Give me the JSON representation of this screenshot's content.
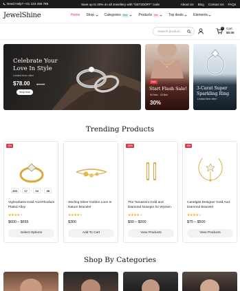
{
  "topbar": {
    "help": "Need Help? +01 123 456 789",
    "promo": "Save up to 20% on all Jewellery with \"GET20OFF\" code",
    "links": [
      "About Us",
      "Blog",
      "Contact Us",
      "FAQs"
    ]
  },
  "header": {
    "logo": "JewelShine",
    "nav": [
      {
        "label": "Home",
        "badge": "",
        "active": true
      },
      {
        "label": "Shop",
        "badge": ""
      },
      {
        "label": "Categories",
        "badge": "New"
      },
      {
        "label": "Products",
        "badge": "Hot"
      },
      {
        "label": "Top deals",
        "badge": ""
      },
      {
        "label": "Elements",
        "badge": ""
      }
    ]
  },
  "search": {
    "placeholder": "Search product..."
  },
  "cart": {
    "count": "0",
    "label": "Cart",
    "total": "$0.00"
  },
  "banners": {
    "main": {
      "title": "Celebrate Your Love In Style",
      "subtitle": "Limited time offer!",
      "price": "$78.00",
      "old_price": "$99.00",
      "button": "Shop Now"
    },
    "flash": {
      "tag": "Sale",
      "title": "Start Flash Sale!",
      "dates": "01 Nov - 15 Nov",
      "discount": "30%"
    },
    "ring": {
      "title": "3-Carat Super Sparkling Ring",
      "subtitle": "Limited time offer!"
    }
  },
  "trending": {
    "title": "Trending Products",
    "products": [
      {
        "discount": "-5%",
        "name": "Vighnaharta Gold And Rhodium Plated Alloy",
        "rating": 4,
        "price": "$600 – $655",
        "action": "Select Options",
        "timer": [
          "335",
          "17",
          "04",
          "38"
        ]
      },
      {
        "discount": "",
        "name": "Sterling Silver Golden Love In Nature Bracelet",
        "rating": 4,
        "price": "$300",
        "action": "Add To Cart"
      },
      {
        "discount": "-33%",
        "name": "The Tamasvini Gold and Diamond Nosepin for Women",
        "rating": 4,
        "price": "$90 – $300",
        "action": "View Products"
      },
      {
        "discount": "-5%",
        "name": "Caratlgits Designer Gold And Diamond Bracelet",
        "rating": 4,
        "price": "$75 – $500",
        "action": "View Products"
      }
    ]
  },
  "categories": {
    "title": "Shop By Categories"
  }
}
